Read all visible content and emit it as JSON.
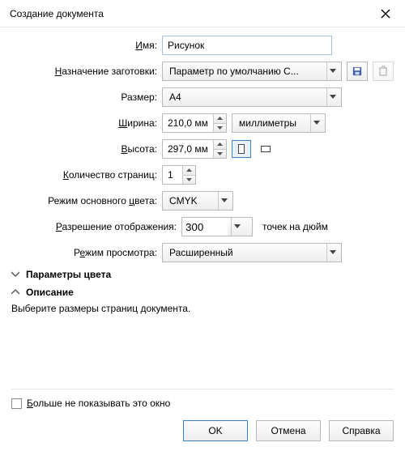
{
  "window": {
    "title": "Создание документа"
  },
  "labels": {
    "name_pre": "",
    "name_u": "И",
    "name_post": "мя:",
    "preset_u": "Н",
    "preset_post": "азначение заготовки:",
    "size": "Размер:",
    "width_pre": "",
    "width_u": "Ш",
    "width_post": "ирина:",
    "height_pre": "",
    "height_u": "В",
    "height_post": "ысота:",
    "pages_pre": "",
    "pages_u": "К",
    "pages_post": "оличество страниц:",
    "color_pre": "Режим основного ",
    "color_u": "ц",
    "color_post": "вета:",
    "res_pre": "",
    "res_u": "Р",
    "res_post": "азрешение отображения:",
    "view_pre": "Р",
    "view_u": "е",
    "view_post": "жим просмотра:"
  },
  "values": {
    "name": "Рисунок",
    "preset": "Параметр по умолчанию C...",
    "size": "A4",
    "width": "210,0 мм",
    "height": "297,0 мм",
    "units": "миллиметры",
    "pages": "1",
    "colorMode": "CMYK",
    "resolution": "300",
    "resolutionUnits": "точек на дюйм",
    "viewMode": "Расширенный"
  },
  "sections": {
    "colorParams": "Параметры цвета",
    "description": "Описание",
    "descriptionText": "Выберите размеры страниц документа."
  },
  "footer": {
    "dontShow_pre": "",
    "dontShow_u": "Б",
    "dontShow_post": "ольше не показывать это окно",
    "ok": "OK",
    "cancel": "Отмена",
    "help": "Справка"
  }
}
